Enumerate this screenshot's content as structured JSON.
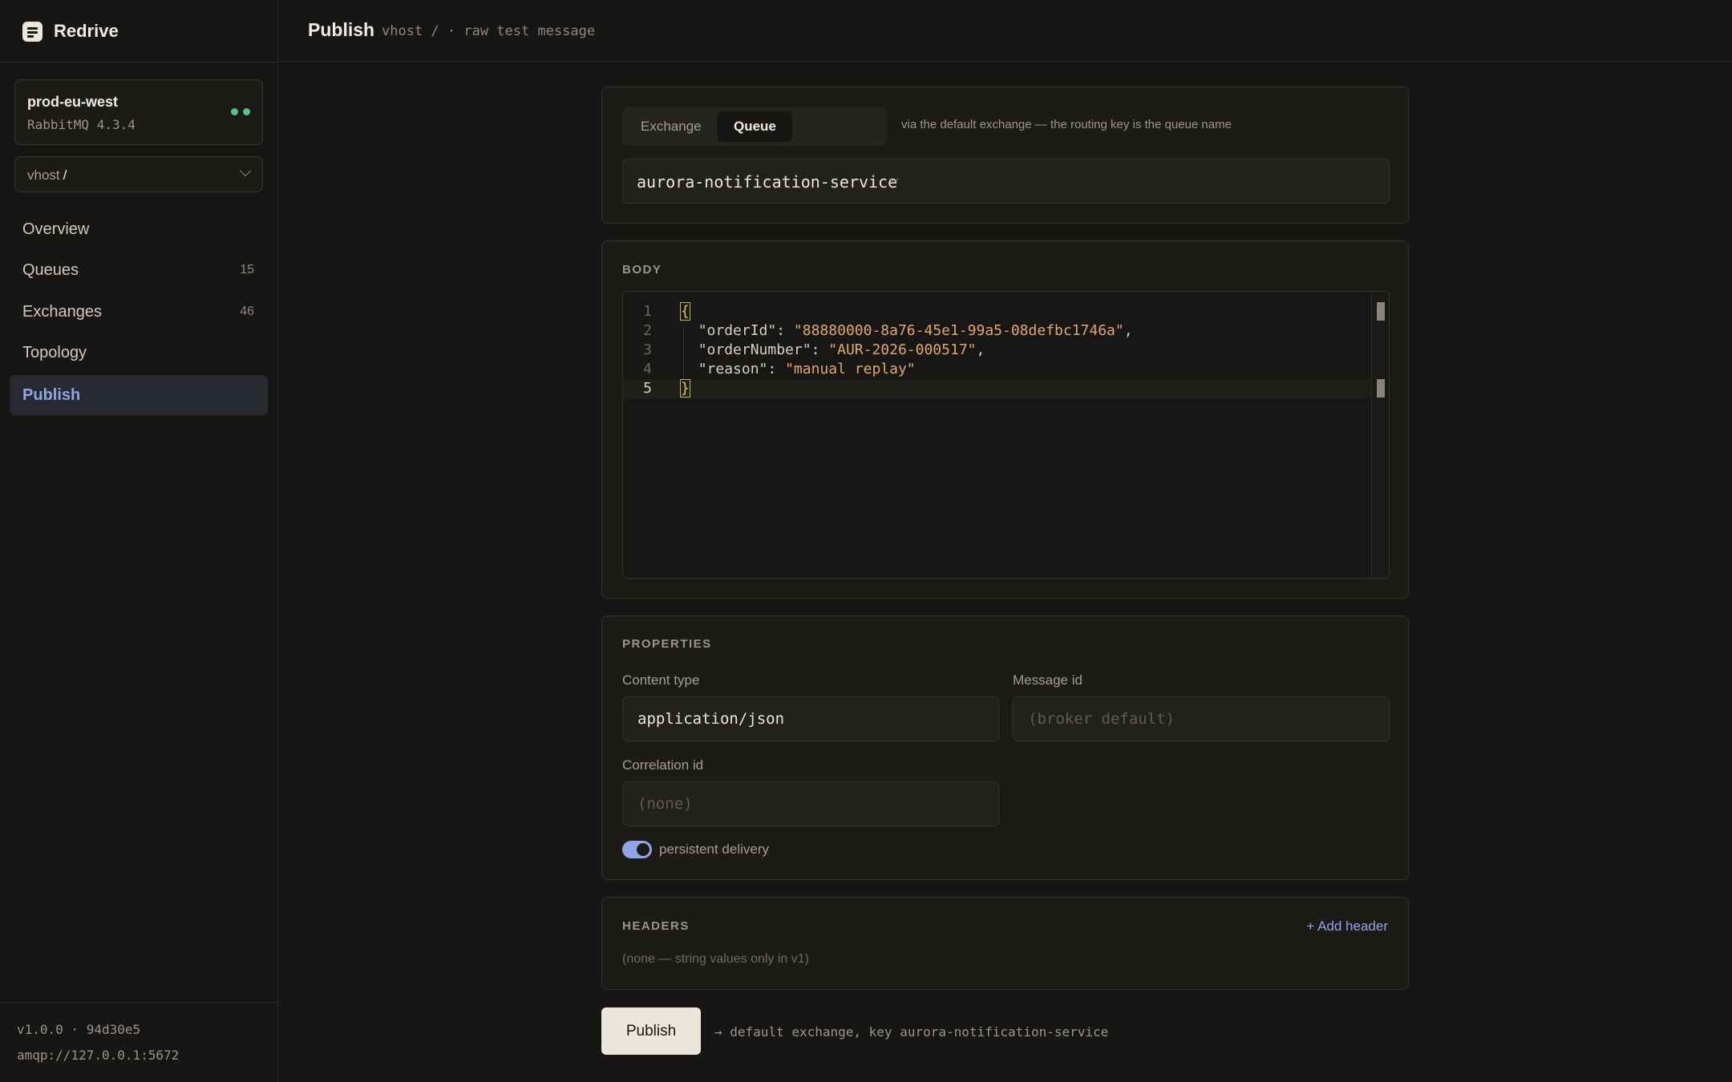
{
  "app": {
    "name": "Redrive"
  },
  "connection": {
    "name": "prod-eu-west",
    "version": "RabbitMQ 4.3.4"
  },
  "vhost": {
    "label": "vhost",
    "value": "/"
  },
  "nav": [
    {
      "label": "Overview",
      "count": ""
    },
    {
      "label": "Queues",
      "count": "15"
    },
    {
      "label": "Exchanges",
      "count": "46"
    },
    {
      "label": "Topology",
      "count": ""
    },
    {
      "label": "Publish",
      "count": ""
    }
  ],
  "active_nav": "Publish",
  "footer": {
    "version": "v1.0.0 · 94d30e5",
    "url": "amqp://127.0.0.1:5672"
  },
  "header": {
    "title": "Publish",
    "breadcrumb": "vhost / · raw test message"
  },
  "target": {
    "tabs": [
      "Exchange",
      "Queue"
    ],
    "selected_tab": "Queue",
    "hint": "via the default exchange — the routing key is the queue name",
    "queue": "aurora-notification-service"
  },
  "body": {
    "label": "BODY",
    "line_numbers": [
      "1",
      "2",
      "3",
      "4",
      "5"
    ],
    "keys": [
      "\"orderId\"",
      "\"orderNumber\"",
      "\"reason\""
    ],
    "values": [
      "\"88880000-8a76-45e1-99a5-08defbc1746a\"",
      "\"AUR-2026-000517\"",
      "\"manual replay\""
    ]
  },
  "properties": {
    "label": "PROPERTIES",
    "content_type_label": "Content type",
    "content_type_value": "application/json",
    "message_id_label": "Message id",
    "message_id_placeholder": "(broker default)",
    "correlation_id_label": "Correlation id",
    "correlation_id_placeholder": "(none)",
    "persistent_label": "persistent delivery",
    "persistent": true
  },
  "headers": {
    "label": "HEADERS",
    "add_label": "+ Add header",
    "empty_text": "(none — string values only in v1)"
  },
  "publish": {
    "button": "Publish",
    "hint": "→ default exchange, key aurora-notification-service"
  },
  "colors": {
    "accent": "#8ea6e6",
    "status_ok": "#5cc08a",
    "background": "#171614"
  }
}
